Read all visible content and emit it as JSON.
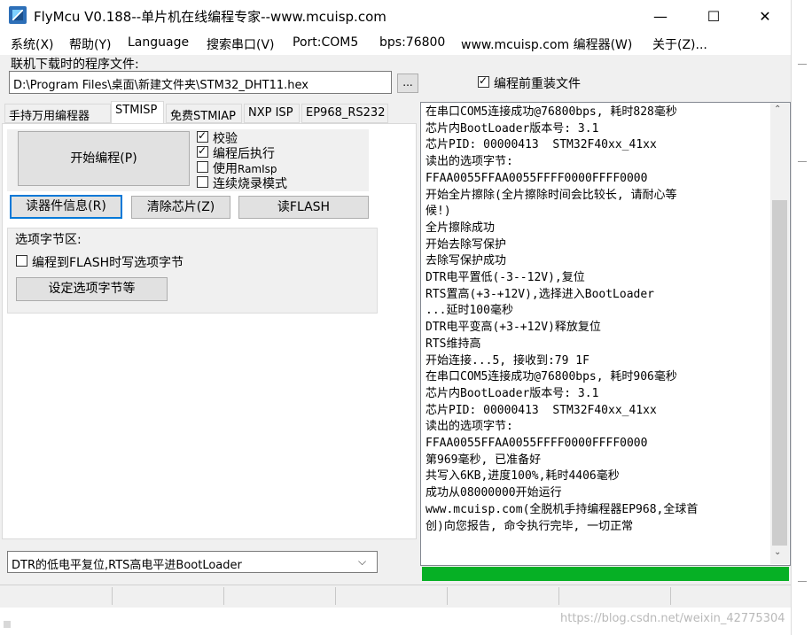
{
  "window": {
    "title": "FlyMcu V0.188--单片机在线编程专家--www.mcuisp.com",
    "minimize": "—",
    "maximize": "☐",
    "close": "✕"
  },
  "menu": [
    "系统(X)",
    "帮助(Y)",
    "Language",
    "搜索串口(V)",
    "Port:COM5",
    "bps:76800",
    "www.mcuisp.com 编程器(W)",
    "关于(Z)..."
  ],
  "file": {
    "label": "联机下载时的程序文件:",
    "path": "D:\\Program Files\\桌面\\新建文件夹\\STM32_DHT11.hex",
    "browse": "...",
    "reload_label": "编程前重装文件",
    "reload_checked": true
  },
  "tabs": [
    "手持万用编程器",
    "STMISP",
    "免费STMIAP",
    "NXP ISP",
    "EP968_RS232"
  ],
  "stmisp": {
    "start_button": "开始编程(P)",
    "verify": "校验",
    "run_after": "编程后执行",
    "use_ramisp_prefix": "使用",
    "use_ramisp_suffix": "RamIsp",
    "continuous": "连续烧录模式",
    "read_info": "读器件信息(R)",
    "erase_chip": "清除芯片(Z)",
    "read_flash": "读FLASH",
    "option_group": "选项字节区:",
    "write_option": "编程到FLASH时写选项字节",
    "set_option": "设定选项字节等",
    "reset_mode": "DTR的低电平复位,RTS高电平进BootLoader"
  },
  "log": [
    "在串口COM5连接成功@76800bps, 耗时828毫秒",
    "芯片内BootLoader版本号: 3.1",
    "芯片PID: 00000413  STM32F40xx_41xx",
    "读出的选项字节:",
    "FFAA0055FFAA0055FFFF0000FFFF0000",
    "开始全片擦除(全片擦除时间会比较长, 请耐心等",
    "候!)",
    "全片擦除成功",
    "开始去除写保护",
    "去除写保护成功",
    "DTR电平置低(-3--12V),复位",
    "RTS置高(+3-+12V),选择进入BootLoader",
    "...延时100毫秒",
    "DTR电平变高(+3-+12V)释放复位",
    "RTS维持高",
    "开始连接...5, 接收到:79 1F",
    "在串口COM5连接成功@76800bps, 耗时906毫秒",
    "芯片内BootLoader版本号: 3.1",
    "芯片PID: 00000413  STM32F40xx_41xx",
    "读出的选项字节:",
    "FFAA0055FFAA0055FFFF0000FFFF0000",
    "第969毫秒, 已准备好",
    "共写入6KB,进度100%,耗时4406毫秒",
    "成功从08000000开始运行",
    "www.mcuisp.com(全脱机手持编程器EP968,全球首",
    "创)向您报告, 命令执行完毕, 一切正常"
  ],
  "progress_fraction": 1.0,
  "colors": {
    "progress": "#06b025",
    "focus": "#0078d7"
  },
  "watermark": "https://blog.csdn.net/weixin_42775304"
}
